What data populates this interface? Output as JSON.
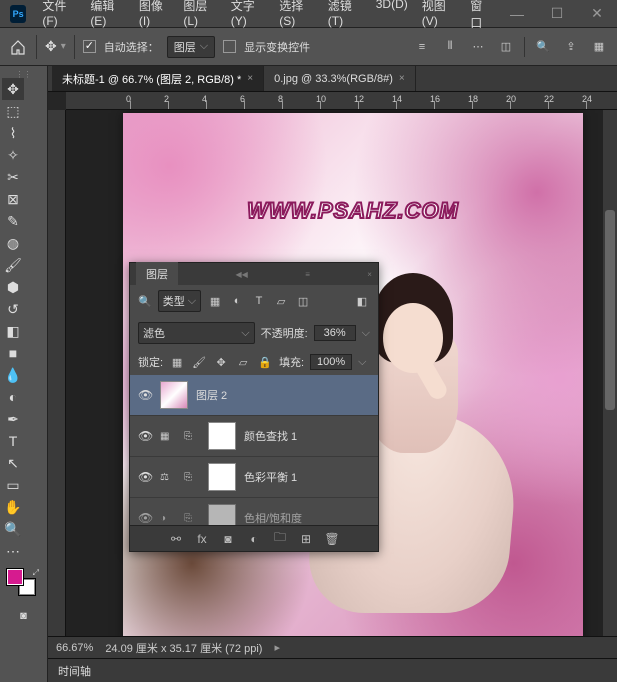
{
  "app": {
    "icon_text": "Ps"
  },
  "menu": {
    "file": "文件(F)",
    "edit": "编辑(E)",
    "image": "图像(I)",
    "layer": "图层(L)",
    "type": "文字(Y)",
    "select": "选择(S)",
    "filter": "滤镜(T)",
    "threed": "3D(D)",
    "view": "视图(V)",
    "window": "窗口"
  },
  "options": {
    "auto_select": "自动选择：",
    "target": "图层",
    "show_transform": "显示变换控件"
  },
  "tabs": [
    {
      "label": "未标题-1 @ 66.7% (图层 2, RGB/8) *",
      "active": true
    },
    {
      "label": "0.jpg @ 33.3%(RGB/8#)",
      "active": false
    }
  ],
  "ruler": {
    "marks": [
      "0",
      "2",
      "4",
      "6",
      "8",
      "10",
      "12",
      "14",
      "16",
      "18",
      "20",
      "22",
      "24"
    ]
  },
  "canvas": {
    "watermark": "WWW.PSAHZ.COM"
  },
  "status": {
    "zoom": "66.67%",
    "dims": "24.09 厘米 x 35.17 厘米 (72 ppi)"
  },
  "timeline": {
    "label": "时间轴"
  },
  "layers_panel": {
    "title": "图层",
    "filter_label": "类型",
    "blend_mode": "滤色",
    "opacity_label": "不透明度:",
    "opacity": "36%",
    "lock_label": "锁定:",
    "fill_label": "填充:",
    "fill": "100%",
    "layers": [
      {
        "name": "图层 2",
        "eyed": true,
        "selected": true,
        "thumb": "img"
      },
      {
        "name": "颜色查找 1",
        "eyed": true,
        "thumb": "cl",
        "icon": "grid"
      },
      {
        "name": "色彩平衡 1",
        "eyed": true,
        "thumb": "cl",
        "icon": "balance"
      },
      {
        "name": "色相/饱和度",
        "eyed": true,
        "thumb": "cl",
        "icon": "adj"
      }
    ]
  }
}
